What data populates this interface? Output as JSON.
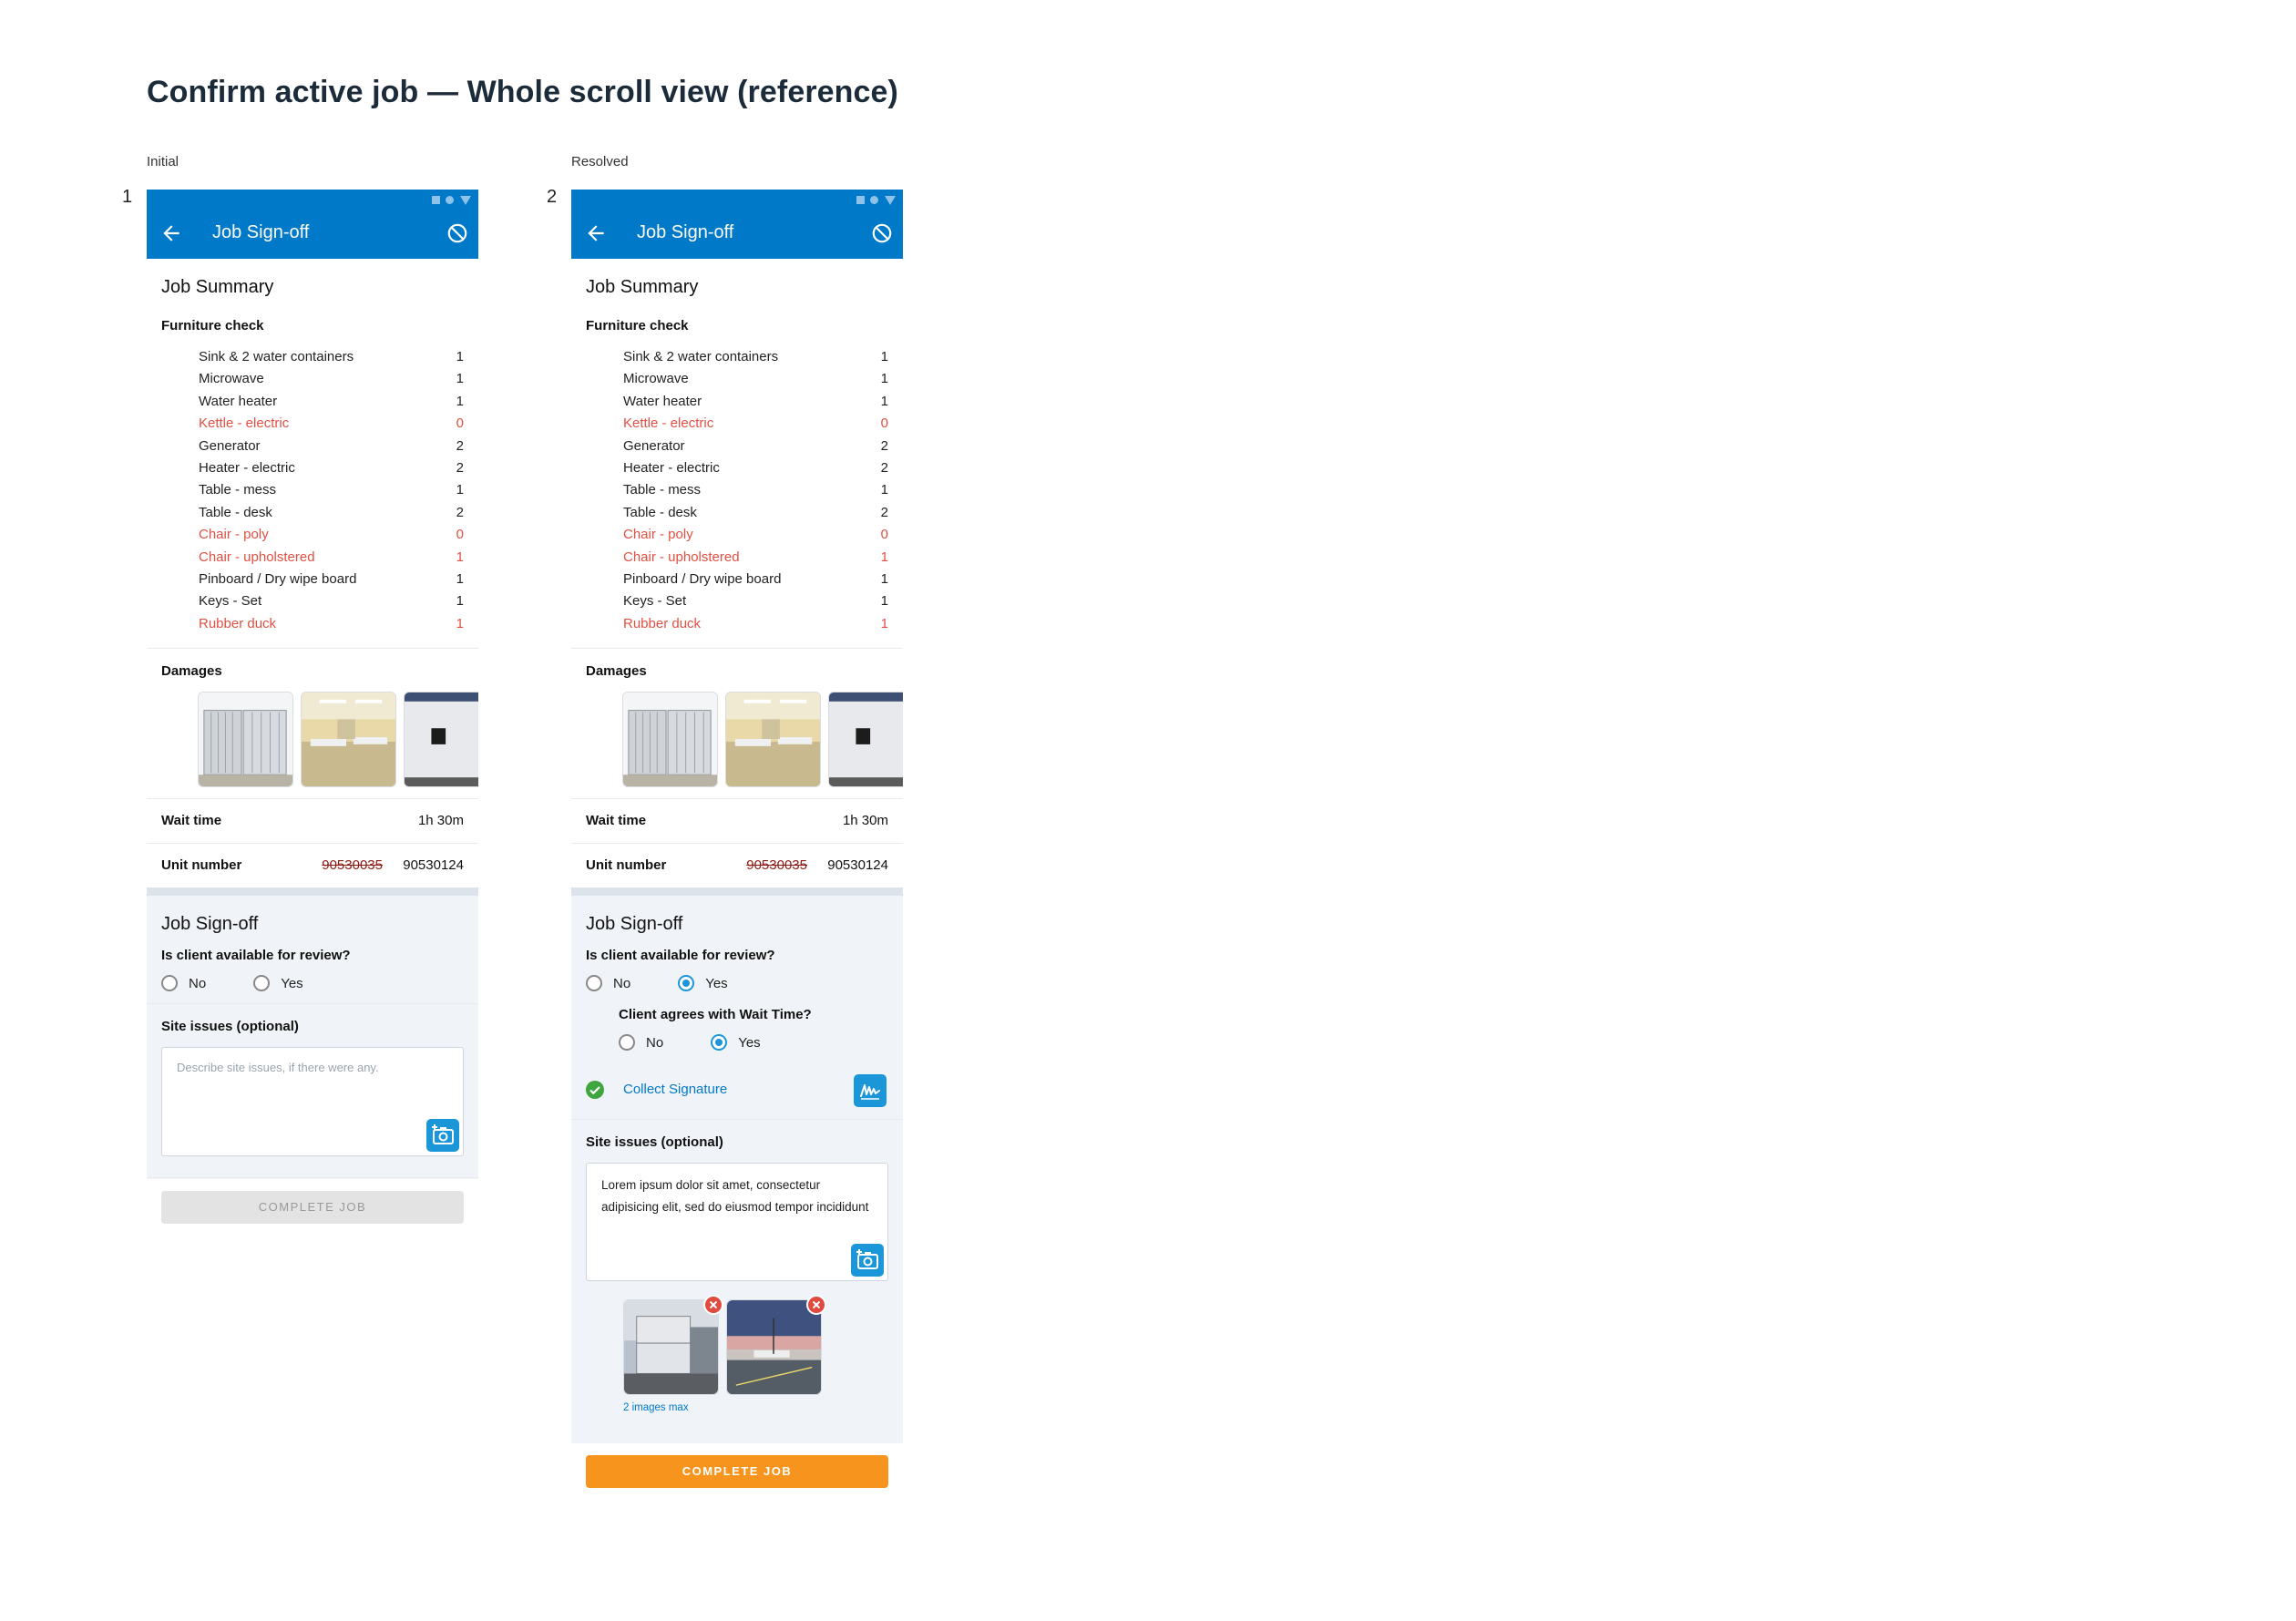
{
  "page_title": "Confirm active job — Whole scroll view (reference)",
  "colors": {
    "app_bar": "#0079c8",
    "accent": "#1b96d9",
    "missing": "#e35043",
    "cta": "#f7941d"
  },
  "screens": [
    {
      "caption": "Initial",
      "number": "1",
      "app_bar_title": "Job Sign-off",
      "summary_title": "Job Summary",
      "furniture_title": "Furniture check",
      "furniture": [
        {
          "name": "Sink & 2 water containers",
          "qty": "1",
          "missing": false
        },
        {
          "name": "Microwave",
          "qty": "1",
          "missing": false
        },
        {
          "name": "Water heater",
          "qty": "1",
          "missing": false
        },
        {
          "name": "Kettle - electric",
          "qty": "0",
          "missing": true
        },
        {
          "name": "Generator",
          "qty": "2",
          "missing": false
        },
        {
          "name": "Heater - electric",
          "qty": "2",
          "missing": false
        },
        {
          "name": "Table - mess",
          "qty": "1",
          "missing": false
        },
        {
          "name": "Table - desk",
          "qty": "2",
          "missing": false
        },
        {
          "name": "Chair - poly",
          "qty": "0",
          "missing": true
        },
        {
          "name": "Chair - upholstered",
          "qty": "1",
          "missing": true
        },
        {
          "name": "Pinboard / Dry wipe board",
          "qty": "1",
          "missing": false
        },
        {
          "name": "Keys - Set",
          "qty": "1",
          "missing": false
        },
        {
          "name": "Rubber duck",
          "qty": "1",
          "missing": true
        }
      ],
      "damages_title": "Damages",
      "wait_time_label": "Wait time",
      "wait_time_value": "1h 30m",
      "unit_number_label": "Unit number",
      "unit_number_old": "90530035",
      "unit_number_new": "90530124",
      "signoff_title": "Job Sign-off",
      "client_question": "Is client available for review?",
      "client_options": [
        "No",
        "Yes"
      ],
      "site_issues_label": "Site issues (optional)",
      "site_issues_placeholder": "Describe site issues, if there were any.",
      "complete_label": "COMPLETE JOB"
    },
    {
      "caption": "Resolved",
      "number": "2",
      "app_bar_title": "Job Sign-off",
      "summary_title": "Job Summary",
      "furniture_title": "Furniture check",
      "furniture": [
        {
          "name": "Sink & 2 water containers",
          "qty": "1",
          "missing": false
        },
        {
          "name": "Microwave",
          "qty": "1",
          "missing": false
        },
        {
          "name": "Water heater",
          "qty": "1",
          "missing": false
        },
        {
          "name": "Kettle - electric",
          "qty": "0",
          "missing": true
        },
        {
          "name": "Generator",
          "qty": "2",
          "missing": false
        },
        {
          "name": "Heater - electric",
          "qty": "2",
          "missing": false
        },
        {
          "name": "Table - mess",
          "qty": "1",
          "missing": false
        },
        {
          "name": "Table - desk",
          "qty": "2",
          "missing": false
        },
        {
          "name": "Chair - poly",
          "qty": "0",
          "missing": true
        },
        {
          "name": "Chair - upholstered",
          "qty": "1",
          "missing": true
        },
        {
          "name": "Pinboard / Dry wipe board",
          "qty": "1",
          "missing": false
        },
        {
          "name": "Keys - Set",
          "qty": "1",
          "missing": false
        },
        {
          "name": "Rubber duck",
          "qty": "1",
          "missing": true
        }
      ],
      "damages_title": "Damages",
      "wait_time_label": "Wait time",
      "wait_time_value": "1h 30m",
      "unit_number_label": "Unit number",
      "unit_number_old": "90530035",
      "unit_number_new": "90530124",
      "signoff_title": "Job Sign-off",
      "client_question": "Is client available for review?",
      "client_options": [
        "No",
        "Yes"
      ],
      "client_selected": "Yes",
      "wait_question": "Client agrees with Wait Time?",
      "wait_options": [
        "No",
        "Yes"
      ],
      "wait_selected": "Yes",
      "collect_signature_label": "Collect Signature",
      "site_issues_label": "Site issues (optional)",
      "site_issues_text": "Lorem ipsum dolor sit amet, consectetur adipisicing elit, sed do eiusmod tempor incididunt",
      "images_max_label": "2 images max",
      "complete_label": "COMPLETE JOB"
    }
  ]
}
